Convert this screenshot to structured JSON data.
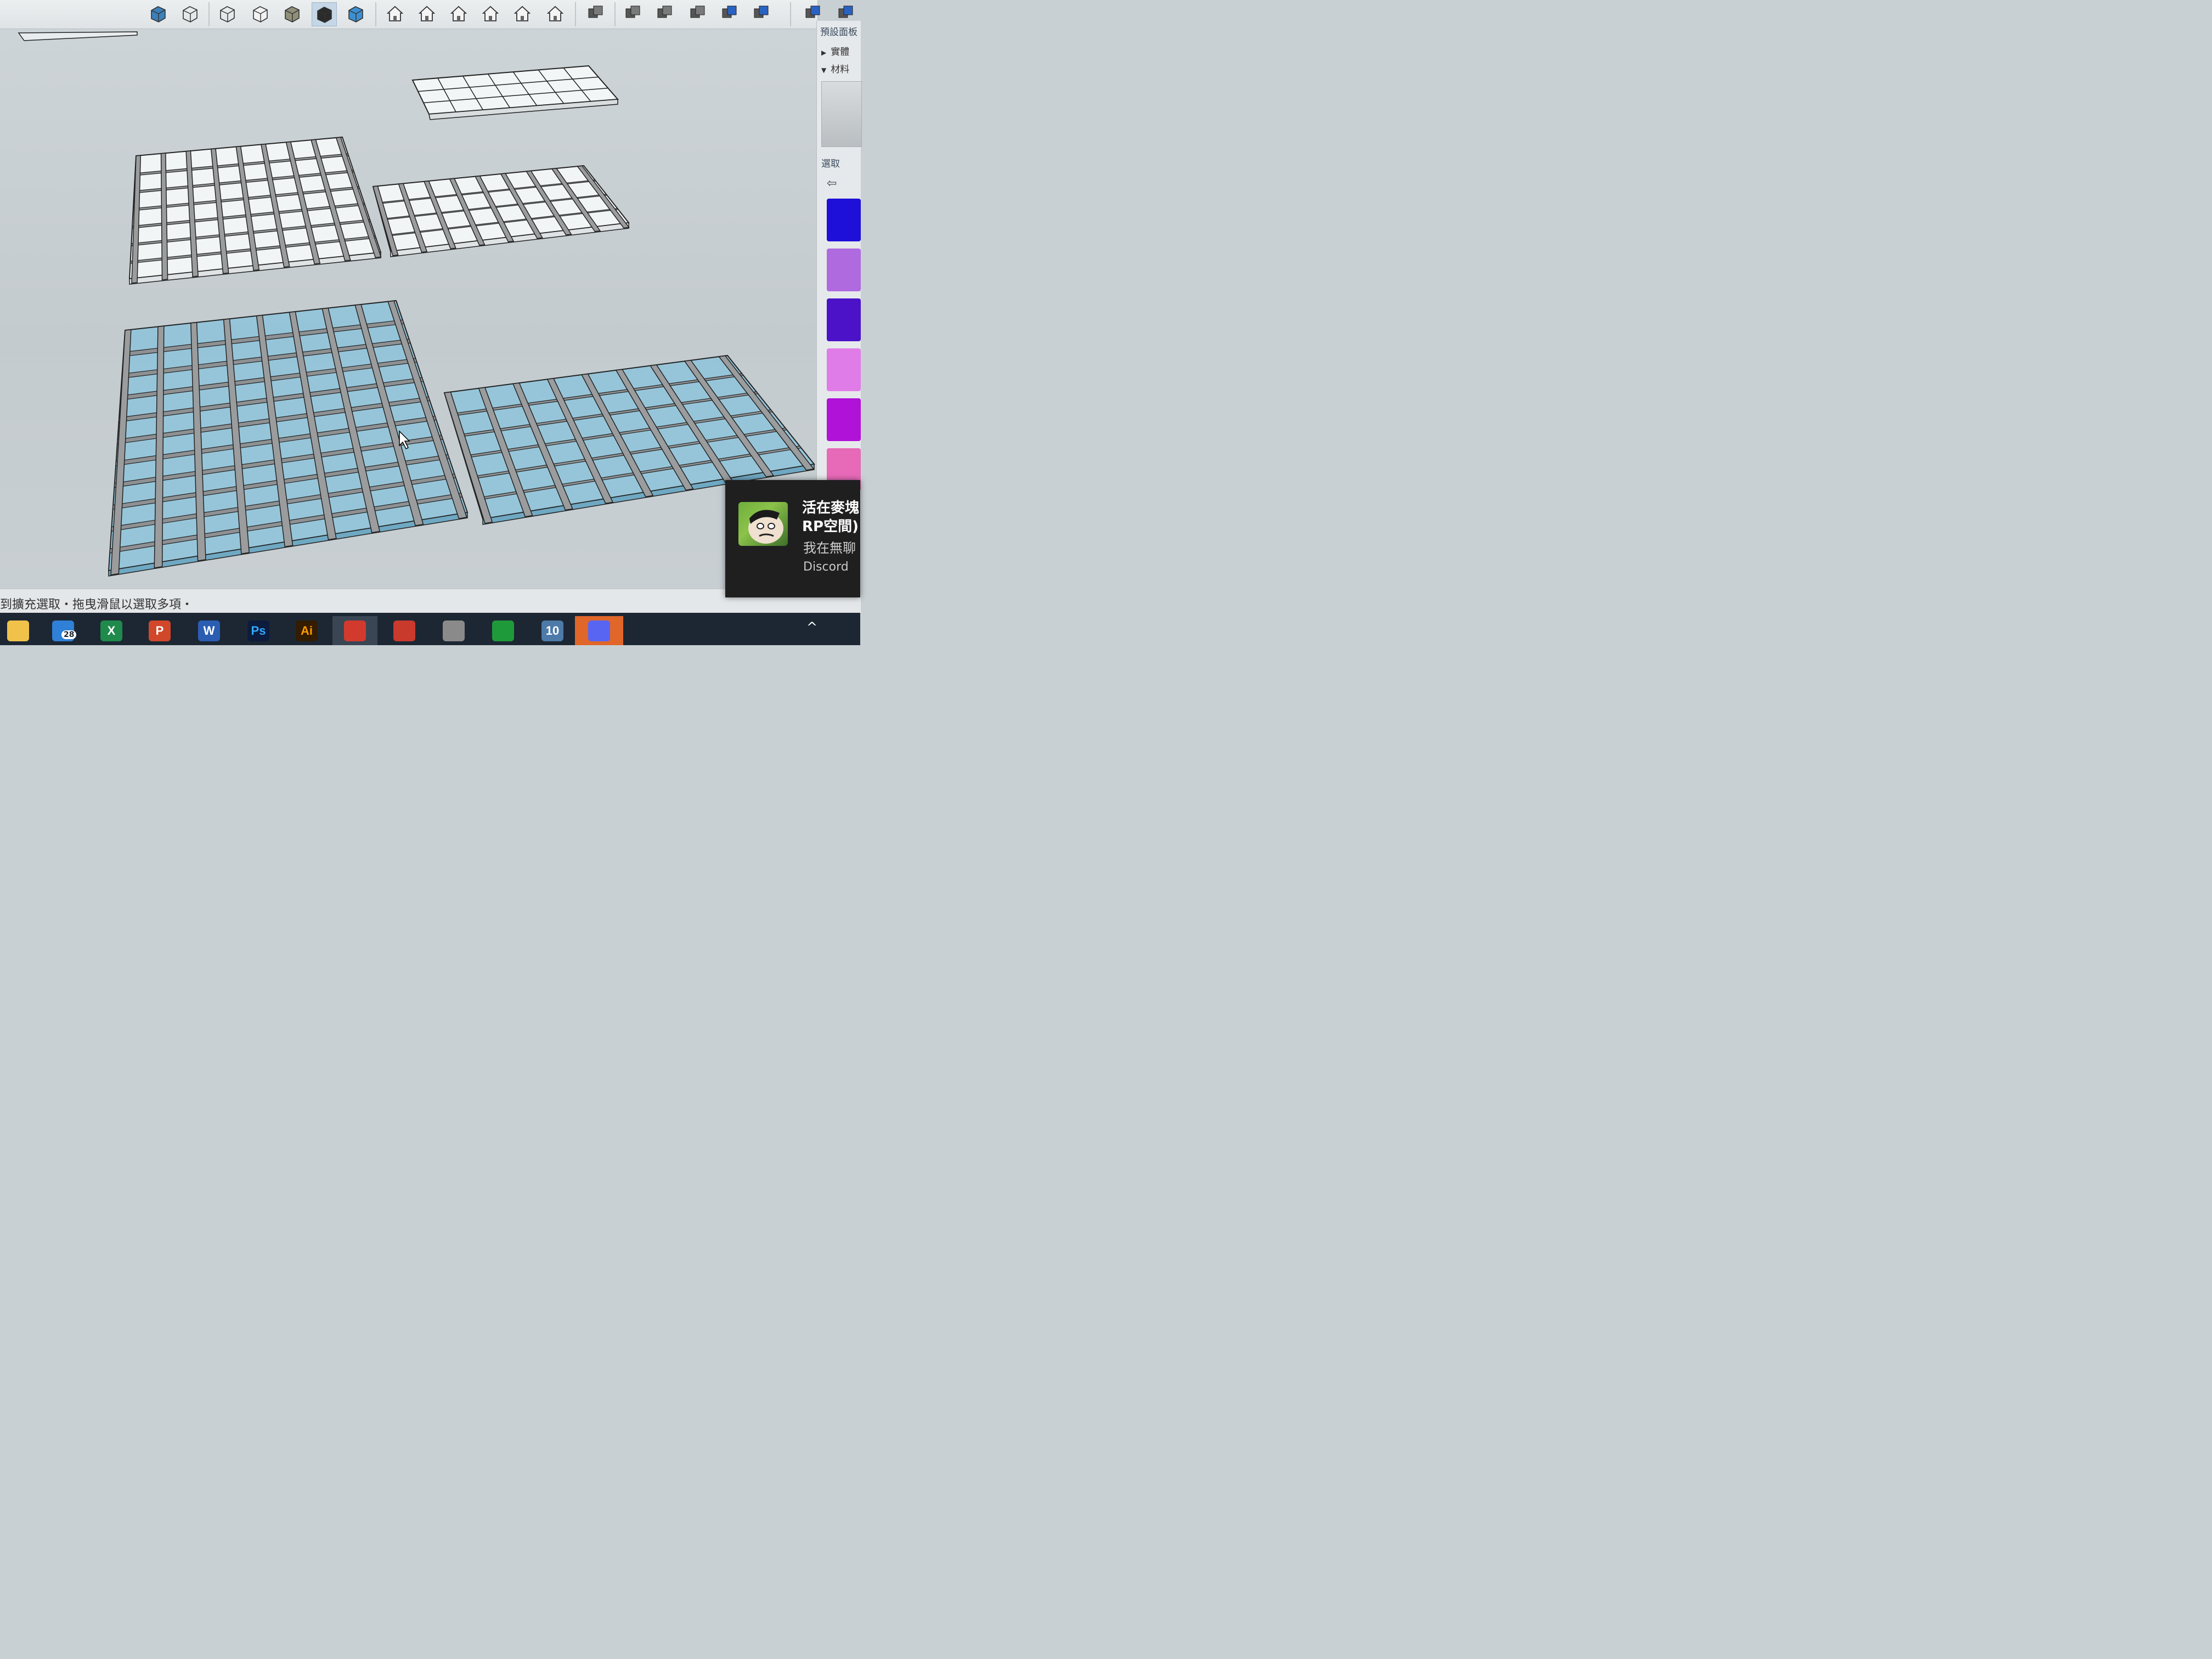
{
  "toolbar": {
    "tools": [
      {
        "icon": "iso-view-icon"
      },
      {
        "icon": "wireframe-cube-icon"
      },
      {
        "icon": "hidden-line-cube-icon"
      },
      {
        "icon": "shaded-cube-outline-icon"
      },
      {
        "icon": "textured-cube-icon"
      },
      {
        "icon": "monochrome-section-icon",
        "active": true
      },
      {
        "icon": "xray-cube-icon"
      },
      {
        "icon": "iso-house-icon"
      },
      {
        "icon": "top-view-icon"
      },
      {
        "icon": "front-view-icon"
      },
      {
        "icon": "right-view-icon"
      },
      {
        "icon": "back-view-icon"
      },
      {
        "icon": "left-view-icon"
      },
      {
        "icon": "outer-shell-icon"
      },
      {
        "icon": "intersect-icon"
      },
      {
        "icon": "union-icon"
      },
      {
        "icon": "subtract-icon"
      },
      {
        "icon": "trim-icon"
      },
      {
        "icon": "split-icon"
      },
      {
        "icon": "walk-icon"
      },
      {
        "icon": "warehouse-icon"
      }
    ]
  },
  "tray": {
    "title": "預設面板",
    "rows": [
      {
        "label": "實體",
        "expanded": false
      },
      {
        "label": "材料",
        "expanded": true
      }
    ],
    "tab_label": "選取",
    "nav_back": "⇦",
    "swatch_colors": [
      "#1e10d8",
      "#b06ae0",
      "#4b12c8",
      "#e07ce8",
      "#b012d8",
      "#e66ab8"
    ]
  },
  "status": {
    "text": "到擴充選取・拖曳滑鼠以選取多項・"
  },
  "taskbar": {
    "apps": [
      {
        "name": "file-explorer",
        "label": "",
        "color": "#f0c24a"
      },
      {
        "name": "mail",
        "label": "",
        "color": "#2f80d6",
        "badge": "28"
      },
      {
        "name": "excel",
        "label": "X",
        "color": "#1f8a4c"
      },
      {
        "name": "powerpoint",
        "label": "P",
        "color": "#d1472a"
      },
      {
        "name": "word",
        "label": "W",
        "color": "#2b5eb3"
      },
      {
        "name": "photoshop",
        "label": "Ps",
        "color": "#0d1c3d",
        "fg": "#31a8ff"
      },
      {
        "name": "illustrator",
        "label": "Ai",
        "color": "#331c00",
        "fg": "#ff9a00"
      },
      {
        "name": "sketchup",
        "label": "",
        "color": "#d23a2e",
        "active": true
      },
      {
        "name": "autocad",
        "label": "",
        "color": "#c9392c"
      },
      {
        "name": "viewer",
        "label": "",
        "color": "#8a8a8a"
      },
      {
        "name": "hexagon-app",
        "label": "",
        "color": "#1f9a3b"
      },
      {
        "name": "calendar-app",
        "label": "10",
        "color": "#4d7aa8"
      },
      {
        "name": "discord",
        "label": "",
        "color": "#5865f2",
        "active": true
      }
    ],
    "system_chevron": "^"
  },
  "notification": {
    "title": "活在麥塊\nRP空間)",
    "message": "我在無聊",
    "app": "Discord"
  },
  "model": {
    "rows_small": 3,
    "cols_small": 7,
    "panels_mid_left_cols": 8,
    "panels_mid_right_cols": 8,
    "glass_color": "#8dc3da",
    "frame_color": "#9a9c9e"
  }
}
